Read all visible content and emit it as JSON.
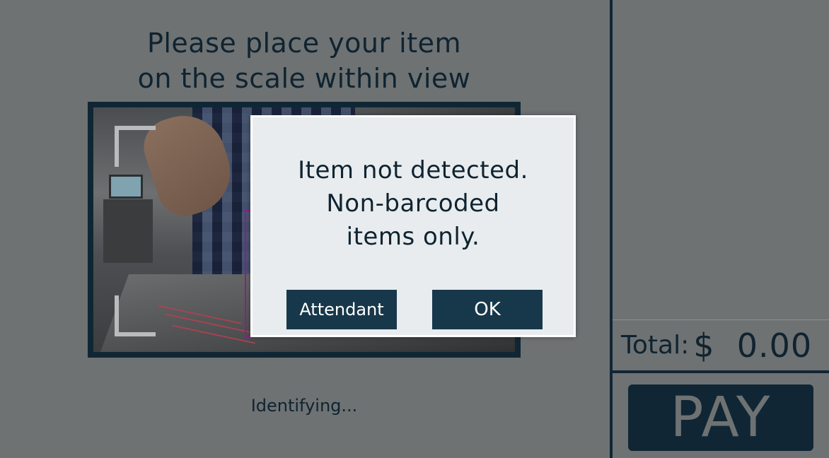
{
  "main": {
    "instruction_line1": "Please place your item",
    "instruction_line2": "on the scale within view",
    "status": "Identifying..."
  },
  "modal": {
    "line1": "Item not detected.",
    "line2": "Non-barcoded",
    "line3": "items only.",
    "attendant_label": "Attendant",
    "ok_label": "OK"
  },
  "right_panel": {
    "total_label": "Total:",
    "total_value": "$  0.00",
    "pay_label": "PAY"
  },
  "colors": {
    "overlay_gray": "#6e7273",
    "navy": "#112634",
    "button_navy": "#17384a",
    "modal_bg": "#e8ecee",
    "detect_box": "#8b1e8b"
  }
}
